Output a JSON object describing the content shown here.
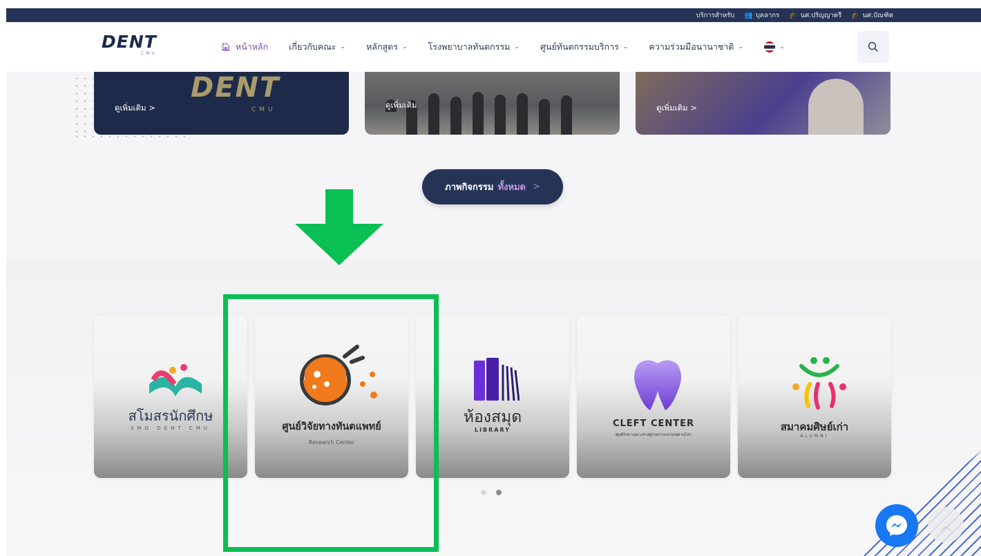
{
  "topbar": {
    "label": "บริการสำหรับ",
    "links": [
      {
        "label": "บุคลากร",
        "icon": "people-icon"
      },
      {
        "label": "นศ.ปริญญาตรี",
        "icon": "graduation-cap-icon"
      },
      {
        "label": "นศ.บัณฑิต",
        "icon": "mortarboard-icon"
      }
    ]
  },
  "logo": {
    "main": "DENT",
    "sub": "CMU"
  },
  "nav": {
    "items": [
      {
        "label": "หน้าหลัก",
        "icon": "home-icon",
        "active": true
      },
      {
        "label": "เกี่ยวกับคณะ",
        "dropdown": true
      },
      {
        "label": "หลักสูตร",
        "dropdown": true
      },
      {
        "label": "โรงพยาบาลทันตกรรม",
        "dropdown": true
      },
      {
        "label": "ศูนย์ทันตกรรมบริการ",
        "dropdown": true
      },
      {
        "label": "ความร่วมมือนานาชาติ",
        "dropdown": true
      }
    ],
    "language": "thai-flag-icon"
  },
  "gallery": {
    "see_more": "ดูเพิ่มเติม",
    "ghost_logo": "DENT",
    "ghost_logo_sub": "CMU"
  },
  "activity_button": {
    "label": "ภาพกิจกรรม",
    "accent": "ทั้งหมด"
  },
  "services": [
    {
      "title": "สโมสรนักศึกษ",
      "subtitle": "SMO DENT CMU"
    },
    {
      "title": "ศูนย์วิจัยทางทันตแพทย์",
      "subtitle": "Research Center"
    },
    {
      "title": "ห้องสมุด",
      "subtitle": "LIBRARY"
    },
    {
      "title": "CLEFT CENTER",
      "subtitle": "ศูนย์รักษาเฉพาะทางผู้ป่วยปากแหว่งเพดานโหว่"
    },
    {
      "title": "สมาคมศิษย์เก่า",
      "subtitle": "ALUMNI"
    }
  ],
  "colors": {
    "navy": "#253456",
    "accent_purple": "#7a4fb0",
    "highlight_green": "#0abf53",
    "messenger_blue": "#1877f2"
  },
  "pager": {
    "count": 2,
    "active_index": 1
  }
}
